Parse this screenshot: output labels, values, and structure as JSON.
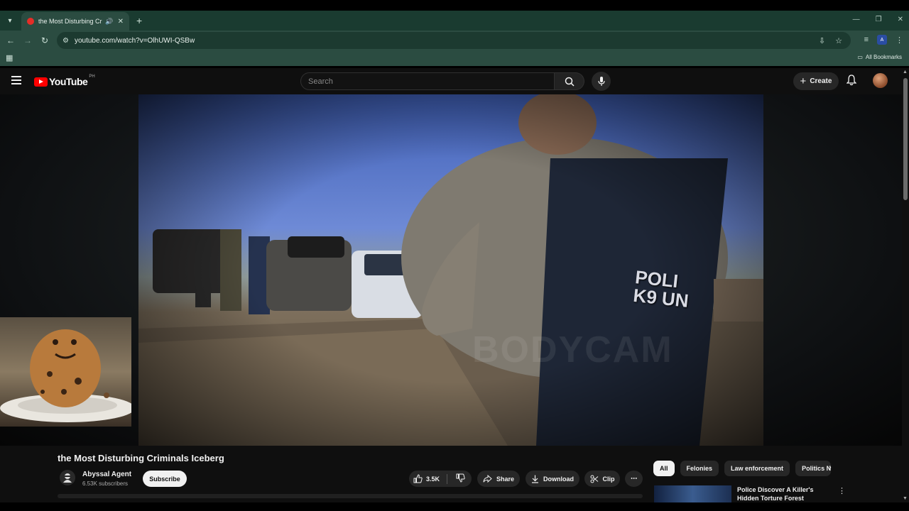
{
  "browser": {
    "tab_title": "the Most Disturbing Criminals Iceberg",
    "url": "youtube.com/watch?v=OlhUWI-QSBw",
    "bookmarks_label": "All Bookmarks",
    "extension_badge": "A"
  },
  "youtube": {
    "logo_text": "YouTube",
    "country_code": "PH",
    "search_placeholder": "Search",
    "create_label": "Create"
  },
  "video": {
    "watermark": "BODYCAM",
    "vest_text": "POLI\nK9 UN",
    "title": "the Most Disturbing Criminals Iceberg",
    "channel_name": "Abyssal Agent",
    "channel_subs": "6.53K subscribers",
    "subscribe_label": "Subscribe",
    "like_count": "3.5K",
    "share_label": "Share",
    "download_label": "Download",
    "clip_label": "Clip"
  },
  "chips": [
    "All",
    "Felonies",
    "Law enforcement",
    "Politics Ne"
  ],
  "recommendation": {
    "title": "Police Discover A Killer's Hidden Torture Forest"
  },
  "colors": {
    "accent_red": "#ff0000",
    "browser_frame": "#2b4c41",
    "page_bg": "#0f0f0f"
  }
}
